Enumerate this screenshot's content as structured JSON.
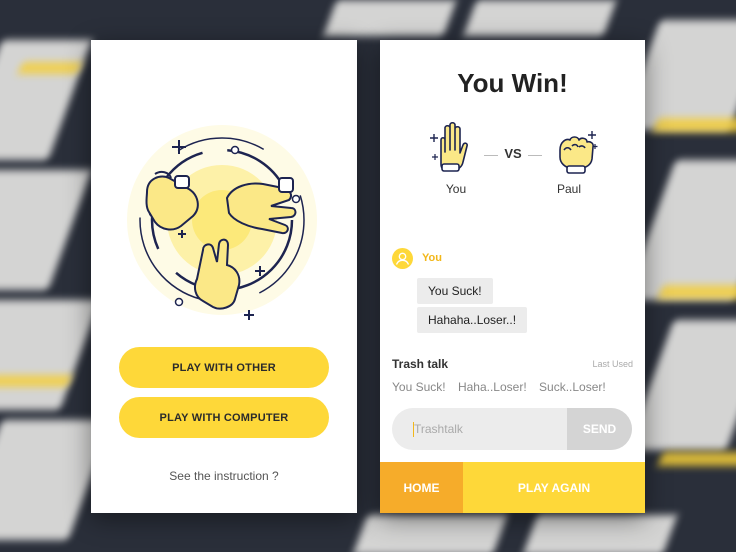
{
  "colors": {
    "accent_yellow": "#fed839",
    "accent_orange": "#f6ac2a",
    "hand_fill": "#fbe887",
    "line_navy": "#1d2450"
  },
  "menu": {
    "play_other": "PLAY WITH OTHER",
    "play_computer": "PLAY WITH COMPUTER",
    "instruction": "See the instruction ?"
  },
  "result": {
    "title": "You Win!",
    "vs": "VS",
    "player": {
      "name": "You",
      "hand": "paper-hand-icon"
    },
    "opponent": {
      "name": "Paul",
      "hand": "rock-hand-icon"
    }
  },
  "chat": {
    "sender": "You",
    "messages": [
      "You Suck!",
      "Hahaha..Loser..!"
    ]
  },
  "trash_talk": {
    "title": "Trash talk",
    "last_used": "Last Used",
    "options": [
      "You Suck!",
      "Haha..Loser!",
      "Suck..Loser!"
    ],
    "placeholder": "Trashtalk",
    "send": "SEND"
  },
  "footer": {
    "home": "HOME",
    "play_again": "PLAY AGAIN"
  }
}
